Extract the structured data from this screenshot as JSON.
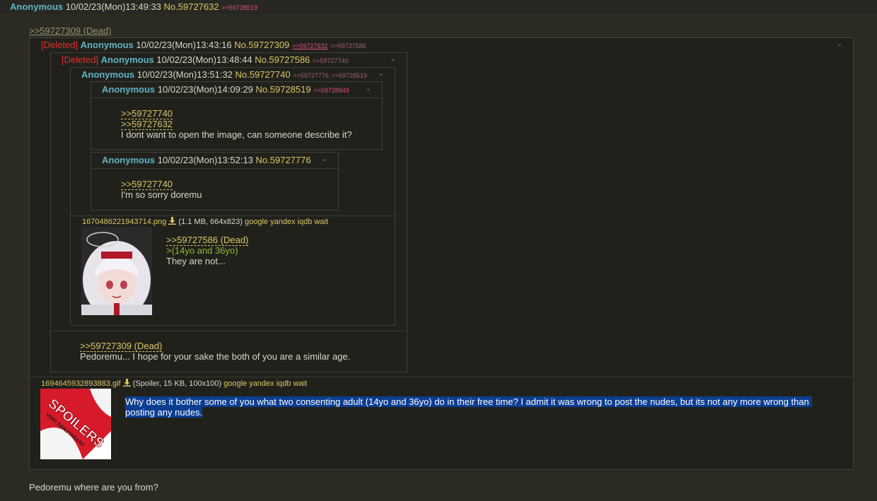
{
  "top_post": {
    "name": "Anonymous",
    "date": "10/02/23(Mon)13:49:33",
    "no": "No.59727632",
    "backlink": ">>59728519"
  },
  "dead_link_top": ">>59727309 (Dead)",
  "post_309": {
    "deleted": "[Deleted]",
    "name": "Anonymous",
    "date": "10/02/23(Mon)13:43:16",
    "no": "No.59727309",
    "backlink1": ">>59727632",
    "backlink2": ">>59727586"
  },
  "post_586": {
    "deleted": "[Deleted]",
    "name": "Anonymous",
    "date": "10/02/23(Mon)13:48:44",
    "no": "No.59727586",
    "backlink": ">>59727740"
  },
  "post_740": {
    "name": "Anonymous",
    "date": "10/02/23(Mon)13:51:32",
    "no": "No.59727740",
    "backlink1": ">>59727776",
    "backlink2": ">>59728519",
    "file": {
      "name": "1670486221943714.png",
      "meta": "(1.1 MB, 664x823)",
      "search": "google yandex iqdb wait"
    },
    "quote": ">>59727586 (Dead)",
    "greentext": ">(14yo and 36yo)",
    "text": "They are not..."
  },
  "post_519": {
    "name": "Anonymous",
    "date": "10/02/23(Mon)14:09:29",
    "no": "No.59728519",
    "backlink": ">>59728949",
    "quote1": ">>59727740",
    "quote2": ">>59727632",
    "text": "I dont want to open the image, can someone describe it?"
  },
  "post_776": {
    "name": "Anonymous",
    "date": "10/02/23(Mon)13:52:13",
    "no": "No.59727776",
    "quote": ">>59727740",
    "text": "I'm so sorry doremu"
  },
  "post_586_body": {
    "quote": ">>59727309 (Dead)",
    "text": "Pedoremu... I hope for your sake the both of you are a similar age."
  },
  "post_309_body": {
    "file": {
      "name": "1694645932893883.gif",
      "meta": "(Spoiler, 15 KB, 100x100)",
      "search": "google yandex iqdb wait"
    },
    "text_line1": "Why does it bother some of you what two consenting adult (14yo and 36yo) do in their free time? I admit it was wrong to post the nudes, but its not any more wrong than",
    "text_line2": "posting any nudes."
  },
  "spoiler": {
    "word": "SPOILERS",
    "sub": "VERY DANJYARASU"
  },
  "bottom_text": "Pedoremu where are you from?",
  "colors": {
    "name": "#5fb3c4",
    "postno": "#dcc664",
    "deleted": "#e03030",
    "backlink": "#e0507c",
    "greentext": "#8fb63b",
    "selection": "#0b3d91"
  }
}
